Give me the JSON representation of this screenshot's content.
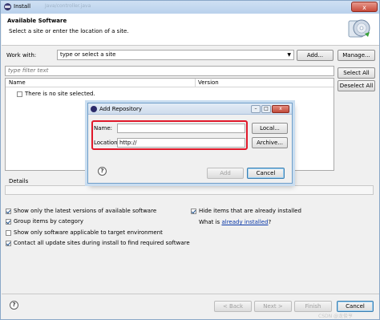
{
  "window": {
    "title": "Install",
    "title_ghost": "Java/controller.java",
    "close_symbol": "x"
  },
  "header": {
    "title": "Available Software",
    "subtitle": "Select a site or enter the location of a site."
  },
  "work_with": {
    "label": "Work with:",
    "placeholder": "type or select a site",
    "add_label": "Add...",
    "manage_label": "Manage..."
  },
  "filter": {
    "placeholder": "type filter text"
  },
  "list": {
    "columns": [
      "Name",
      "Version"
    ],
    "empty_message": "There is no site selected."
  },
  "side_buttons": {
    "select_all": "Select All",
    "deselect_all": "Deselect All"
  },
  "details": {
    "label": "Details"
  },
  "options": {
    "left": [
      {
        "label": "Show only the latest versions of available software",
        "checked": true
      },
      {
        "label": "Group items by category",
        "checked": true
      },
      {
        "label": "Show only software applicable to target environment",
        "checked": false
      },
      {
        "label": "Contact all update sites during install to find required software",
        "checked": true
      }
    ],
    "hide_installed": {
      "label": "Hide items that are already installed",
      "checked": true
    },
    "what_is_prefix": "What is",
    "what_is_link": "already installed",
    "what_is_suffix": "?"
  },
  "footer": {
    "back": "< Back",
    "next": "Next >",
    "finish": "Finish",
    "cancel": "Cancel",
    "watermark": "CSDN @龙俊亨"
  },
  "dialog": {
    "title": "Add Repository",
    "name_label": "Name:",
    "name_value": "",
    "location_label": "Location:",
    "location_value": "http://",
    "local_button": "Local...",
    "archive_button": "Archive...",
    "add_button": "Add",
    "cancel_button": "Cancel",
    "highlight_color": "#e0192a"
  }
}
